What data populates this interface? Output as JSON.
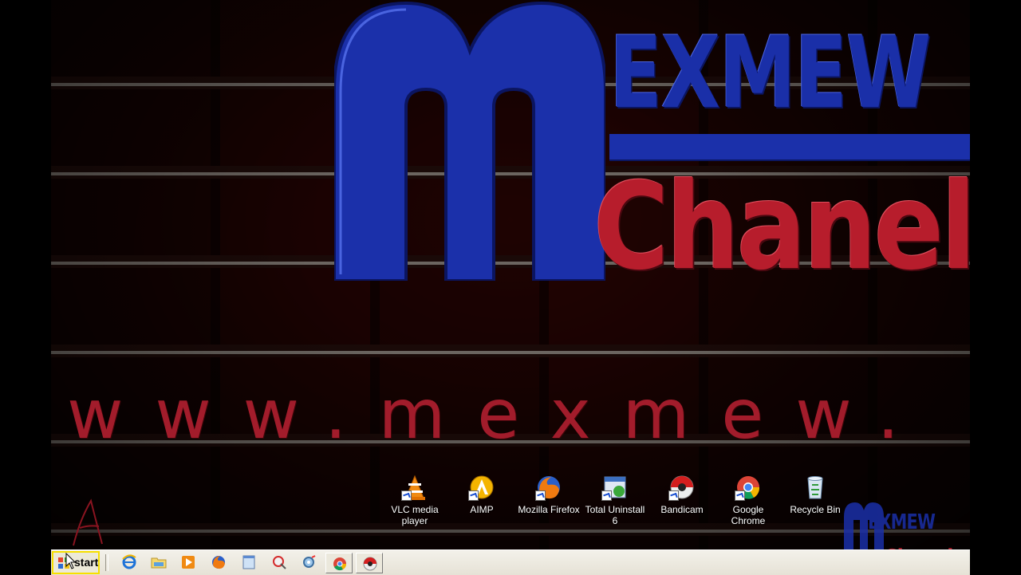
{
  "logo": {
    "exmew": "EXMEW",
    "chanel": "Chanel",
    "url": "www.mexmew."
  },
  "desktop_icons": [
    {
      "label": "VLC media player",
      "icon": "vlc-icon"
    },
    {
      "label": "AIMP",
      "icon": "aimp-icon"
    },
    {
      "label": "Mozilla Firefox",
      "icon": "firefox-icon"
    },
    {
      "label": "Total Uninstall 6",
      "icon": "total-uninstall-icon"
    },
    {
      "label": "Bandicam",
      "icon": "bandicam-icon"
    },
    {
      "label": "Google Chrome",
      "icon": "chrome-icon"
    },
    {
      "label": "Recycle Bin",
      "icon": "recycle-bin-icon"
    }
  ],
  "watermark": {
    "exmew": "EXMEW",
    "chanel": "Chanel"
  },
  "taskbar": {
    "start_label": "start",
    "quick_launch": [
      "ie-icon",
      "folder-icon",
      "media-icon",
      "firefox-icon",
      "window-icon",
      "paint-icon",
      "gear-icon"
    ],
    "tasks": [
      "chrome-icon",
      "bandicam-icon"
    ]
  },
  "colors": {
    "logo_blue": "#1a2fa8",
    "logo_red": "#b71d2c",
    "taskbar": "#ece9d8"
  }
}
